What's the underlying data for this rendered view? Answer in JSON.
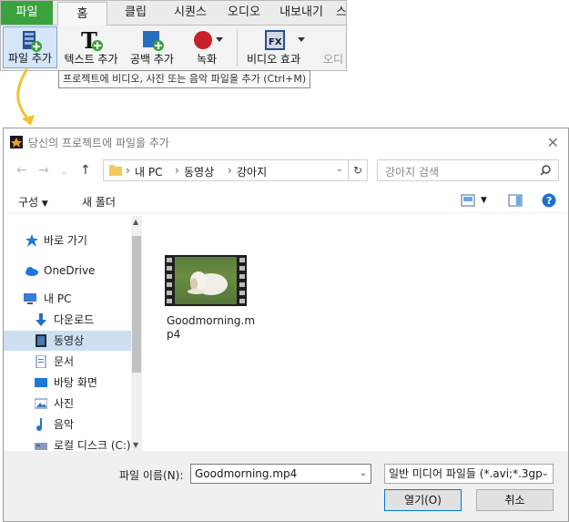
{
  "ribbon": {
    "tabs": [
      {
        "label": "파일"
      },
      {
        "label": "홈"
      },
      {
        "label": "클립"
      },
      {
        "label": "시퀀스"
      },
      {
        "label": "오디오"
      },
      {
        "label": "내보내기"
      },
      {
        "label": "스"
      }
    ],
    "buttons": [
      {
        "label": "파일 추가"
      },
      {
        "label": "텍스트 추가"
      },
      {
        "label": "공백 추가"
      },
      {
        "label": "녹화"
      },
      {
        "label": "비디오 효과"
      },
      {
        "label": "오디"
      }
    ],
    "tooltip": "프로젝트에 비디오, 사진 또는 음악 파일을 추가 (Ctrl+M)"
  },
  "dialog": {
    "title": "당신의 프로젝트에 파일을 추가",
    "breadcrumb": [
      "내 PC",
      "동영상",
      "강아지"
    ],
    "search_placeholder": "강아지 검색",
    "commands": {
      "organize": "구성",
      "new_folder": "새 폴더"
    },
    "nav": [
      {
        "label": "바로 가기",
        "icon": "star-icon"
      },
      {
        "label": "OneDrive",
        "icon": "cloud-icon"
      },
      {
        "label": "내 PC",
        "icon": "computer-icon"
      },
      {
        "label": "다운로드",
        "icon": "download-icon"
      },
      {
        "label": "동영상",
        "icon": "video-folder-icon",
        "selected": true
      },
      {
        "label": "문서",
        "icon": "document-icon"
      },
      {
        "label": "바탕 화면",
        "icon": "desktop-icon"
      },
      {
        "label": "사진",
        "icon": "picture-icon"
      },
      {
        "label": "음악",
        "icon": "music-icon"
      },
      {
        "label": "로컬 디스크 (C:)",
        "icon": "disk-icon"
      }
    ],
    "file": {
      "name": "Goodmorning.mp4"
    },
    "filename_label": "파일 이름(N):",
    "filename_value": "Goodmorning.mp4",
    "filter_value": "일반 미디어 파일들 (*.avi;*.3gp",
    "open_button": "열기(O)",
    "cancel_button": "취소"
  },
  "colors": {
    "file_tab": "#3ba33b",
    "selection": "#cde0f3",
    "accent": "#0078d7"
  }
}
